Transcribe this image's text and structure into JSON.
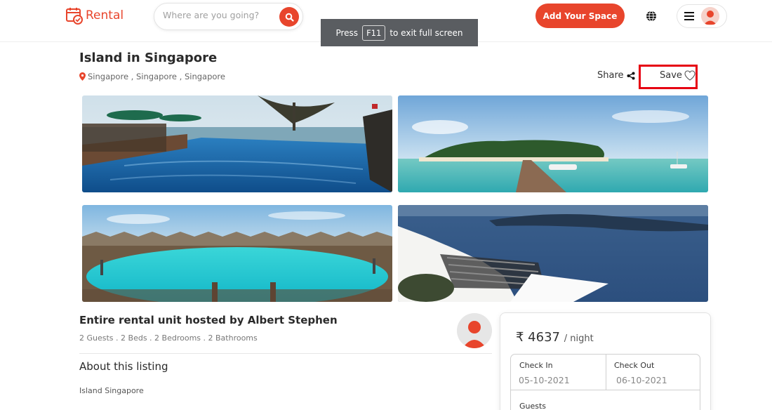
{
  "header": {
    "brand": "Rental",
    "search_placeholder": "Where are you going?",
    "add_space_label": "Add Your Space"
  },
  "fullscreen_notice": {
    "prefix": "Press",
    "key": "F11",
    "suffix": "to exit full screen"
  },
  "listing": {
    "title": "Island in Singapore",
    "location": "Singapore , Singapore , Singapore",
    "share_label": "Share",
    "save_label": "Save",
    "host_heading": "Entire rental unit hosted by Albert Stephen",
    "specs": "2 Guests . 2 Beds . 2 Bedrooms . 2 Bathrooms",
    "about_heading": "About this listing",
    "about_text": "Island Singapore"
  },
  "booking": {
    "price": "₹ 4637",
    "price_unit": "/ night",
    "check_in_label": "Check In",
    "check_in_value": "05-10-2021",
    "check_out_label": "Check Out",
    "check_out_value": "06-10-2021",
    "guests_label": "Guests"
  },
  "colors": {
    "accent": "#e8452c",
    "highlight": "#e60012"
  }
}
